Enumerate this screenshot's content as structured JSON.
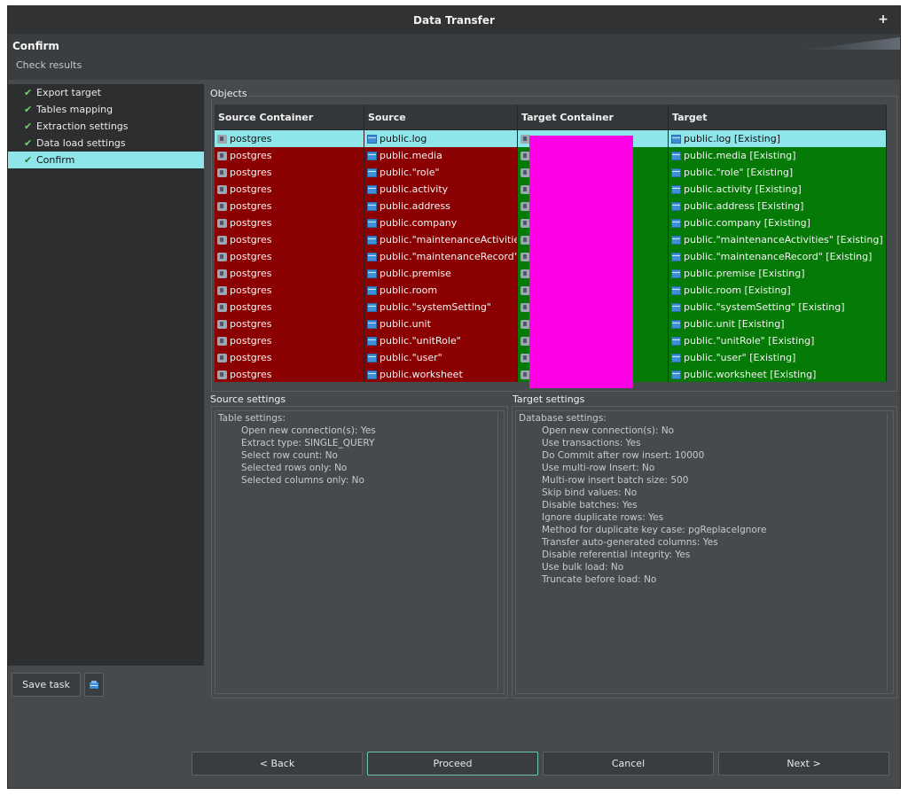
{
  "window": {
    "title": "Data Transfer",
    "plus_icon": "plus-icon"
  },
  "header": {
    "title": "Confirm",
    "subtitle": "Check results"
  },
  "sidebar": {
    "items": [
      {
        "label": "Export target",
        "active": false
      },
      {
        "label": "Tables mapping",
        "active": false
      },
      {
        "label": "Extraction settings",
        "active": false
      },
      {
        "label": "Data load settings",
        "active": false
      },
      {
        "label": "Confirm",
        "active": true
      }
    ]
  },
  "save_task": {
    "label": "Save task",
    "icon": "save-icon"
  },
  "objects": {
    "label": "Objects",
    "columns": [
      "Source Container",
      "Source",
      "Target Container",
      "Target"
    ],
    "rows": [
      {
        "source_container": "postgres",
        "source": "public.log",
        "target_container": "",
        "target": "public.log [Existing]"
      },
      {
        "source_container": "postgres",
        "source": "public.media",
        "target_container": "",
        "target": "public.media [Existing]"
      },
      {
        "source_container": "postgres",
        "source": "public.\"role\"",
        "target_container": "",
        "target": "public.\"role\" [Existing]"
      },
      {
        "source_container": "postgres",
        "source": "public.activity",
        "target_container": "",
        "target": "public.activity [Existing]"
      },
      {
        "source_container": "postgres",
        "source": "public.address",
        "target_container": "",
        "target": "public.address [Existing]"
      },
      {
        "source_container": "postgres",
        "source": "public.company",
        "target_container": "",
        "target": "public.company [Existing]"
      },
      {
        "source_container": "postgres",
        "source": "public.\"maintenanceActivities\"",
        "target_container": "",
        "target": "public.\"maintenanceActivities\" [Existing]"
      },
      {
        "source_container": "postgres",
        "source": "public.\"maintenanceRecord\"",
        "target_container": "",
        "target": "public.\"maintenanceRecord\" [Existing]"
      },
      {
        "source_container": "postgres",
        "source": "public.premise",
        "target_container": "",
        "target": "public.premise [Existing]"
      },
      {
        "source_container": "postgres",
        "source": "public.room",
        "target_container": "",
        "target": "public.room [Existing]"
      },
      {
        "source_container": "postgres",
        "source": "public.\"systemSetting\"",
        "target_container": "",
        "target": "public.\"systemSetting\" [Existing]"
      },
      {
        "source_container": "postgres",
        "source": "public.unit",
        "target_container": "",
        "target": "public.unit [Existing]"
      },
      {
        "source_container": "postgres",
        "source": "public.\"unitRole\"",
        "target_container": "",
        "target": "public.\"unitRole\" [Existing]"
      },
      {
        "source_container": "postgres",
        "source": "public.\"user\"",
        "target_container": "",
        "target": "public.\"user\" [Existing]"
      },
      {
        "source_container": "postgres",
        "source": "public.worksheet",
        "target_container": "",
        "target": "public.worksheet [Existing]"
      }
    ]
  },
  "source_settings": {
    "label": "Source settings",
    "heading": "Table settings:",
    "lines": [
      "Open new connection(s): Yes",
      "Extract type: SINGLE_QUERY",
      "Select row count: No",
      "Selected rows only: No",
      "Selected columns only: No"
    ]
  },
  "target_settings": {
    "label": "Target settings",
    "heading": "Database settings:",
    "lines": [
      "Open new connection(s): No",
      "Use transactions: Yes",
      "Do Commit after row insert: 10000",
      "Use multi-row Insert: No",
      "Multi-row insert batch size: 500",
      "Skip bind values: No",
      "Disable batches: Yes",
      "Ignore duplicate rows: Yes",
      "Method for duplicate key case: pgReplaceIgnore",
      "Transfer auto-generated columns: Yes",
      "Disable referential integrity: Yes",
      "Use bulk load: No",
      "Truncate before load: No"
    ]
  },
  "buttons": {
    "back": "< Back",
    "proceed": "Proceed",
    "cancel": "Cancel",
    "next": "Next >"
  },
  "colors": {
    "row_source": "#8b0000",
    "row_target": "#067a06",
    "selection": "#8fe6ea",
    "redaction": "#ff00e6"
  }
}
